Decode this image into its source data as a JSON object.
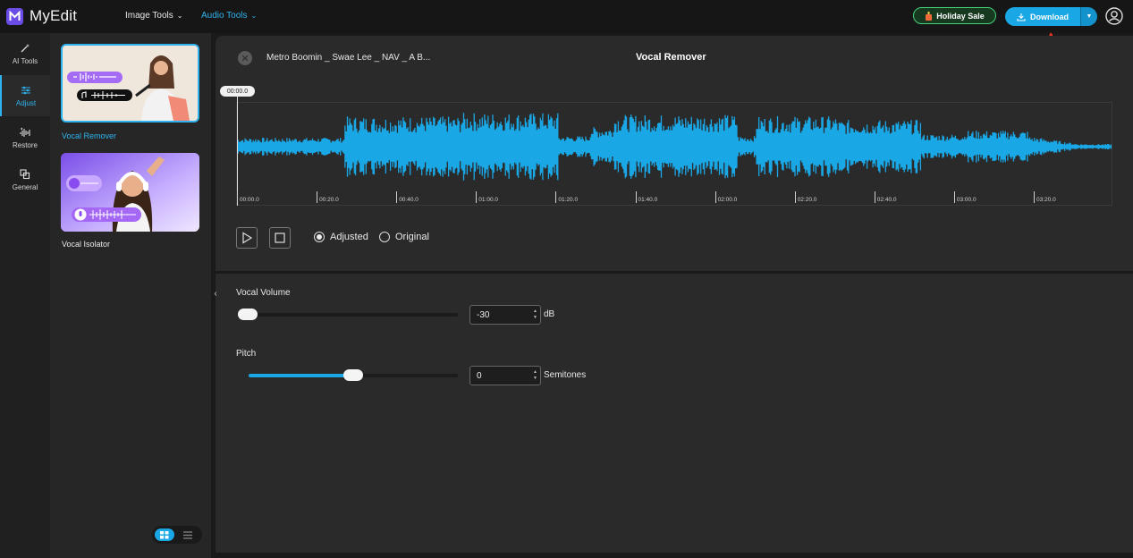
{
  "app": {
    "name": "MyEdit"
  },
  "nav": {
    "image_tools": "Image Tools",
    "audio_tools": "Audio Tools"
  },
  "header": {
    "holiday_sale": "Holiday Sale",
    "download": "Download"
  },
  "rail": {
    "items": [
      {
        "label": "AI Tools",
        "icon": "magic-wand-icon"
      },
      {
        "label": "Adjust",
        "icon": "sliders-icon"
      },
      {
        "label": "Restore",
        "icon": "restore-waveform-icon"
      },
      {
        "label": "General",
        "icon": "crop-icon"
      }
    ]
  },
  "tools": {
    "items": [
      {
        "label": "Vocal Remover",
        "selected": true
      },
      {
        "label": "Vocal Isolator",
        "selected": false
      }
    ]
  },
  "editor": {
    "filename": "Metro Boomin _ Swae Lee _ NAV _ A B...",
    "title": "Vocal Remover",
    "playhead_time": "00:00.0",
    "ruler": [
      "00:00.0",
      "00:20.0",
      "00:40.0",
      "01:00.0",
      "01:20.0",
      "01:40.0",
      "02:00.0",
      "02:20.0",
      "02:40.0",
      "03:00.0",
      "03:20.0"
    ],
    "modes": {
      "adjusted": "Adjusted",
      "original": "Original",
      "selected": "Adjusted"
    },
    "waveform_color": "#1aa7e5"
  },
  "controls": {
    "vocal_volume": {
      "label": "Vocal Volume",
      "value": "-30",
      "unit": "dB",
      "fraction": 0.0
    },
    "pitch": {
      "label": "Pitch",
      "value": "0",
      "unit": "Semitones",
      "fraction": 0.5
    }
  },
  "colors": {
    "accent": "#1aa7e5",
    "holiday_border": "#46d37a",
    "annotation_arrow": "#e8331e"
  }
}
